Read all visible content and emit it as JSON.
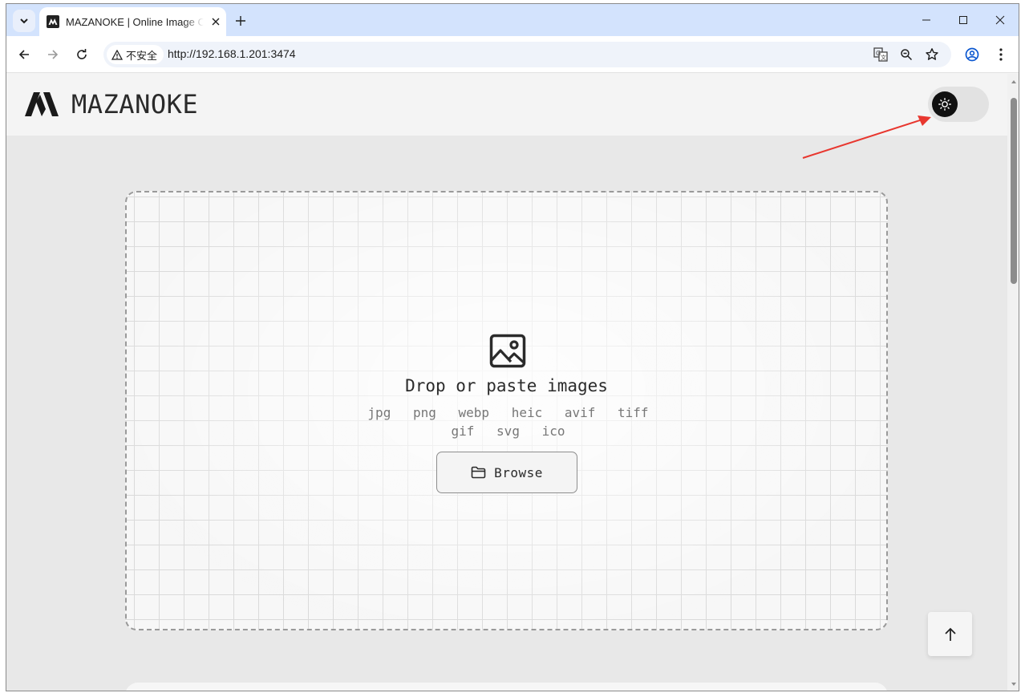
{
  "browser": {
    "tab_title": "MAZANOKE | Online Image Converter",
    "security_label": "不安全",
    "url": "http://192.168.1.201:3474",
    "icons": [
      "tab-search-icon",
      "close-icon",
      "plus-icon",
      "minimize-icon",
      "maximize-icon",
      "close-window-icon",
      "back-arrow-icon",
      "forward-arrow-icon",
      "reload-icon",
      "warning-icon",
      "translate-icon",
      "zoom-icon",
      "star-icon",
      "profile-icon",
      "menu-dots-icon"
    ]
  },
  "site": {
    "brand_name": "MAZANOKE",
    "theme_toggle_icon": "sun-icon"
  },
  "dropzone": {
    "title": "Drop or paste images",
    "formats_row1": [
      "jpg",
      "png",
      "webp",
      "heic",
      "avif",
      "tiff"
    ],
    "formats_row2": [
      "gif",
      "svg",
      "ico"
    ],
    "browse_label": "Browse",
    "icon": "image-icon"
  },
  "colors": {
    "annotation_arrow": "#e8372f",
    "tab_strip": "#d3e3fd",
    "page_bg": "#e8e8e8"
  }
}
